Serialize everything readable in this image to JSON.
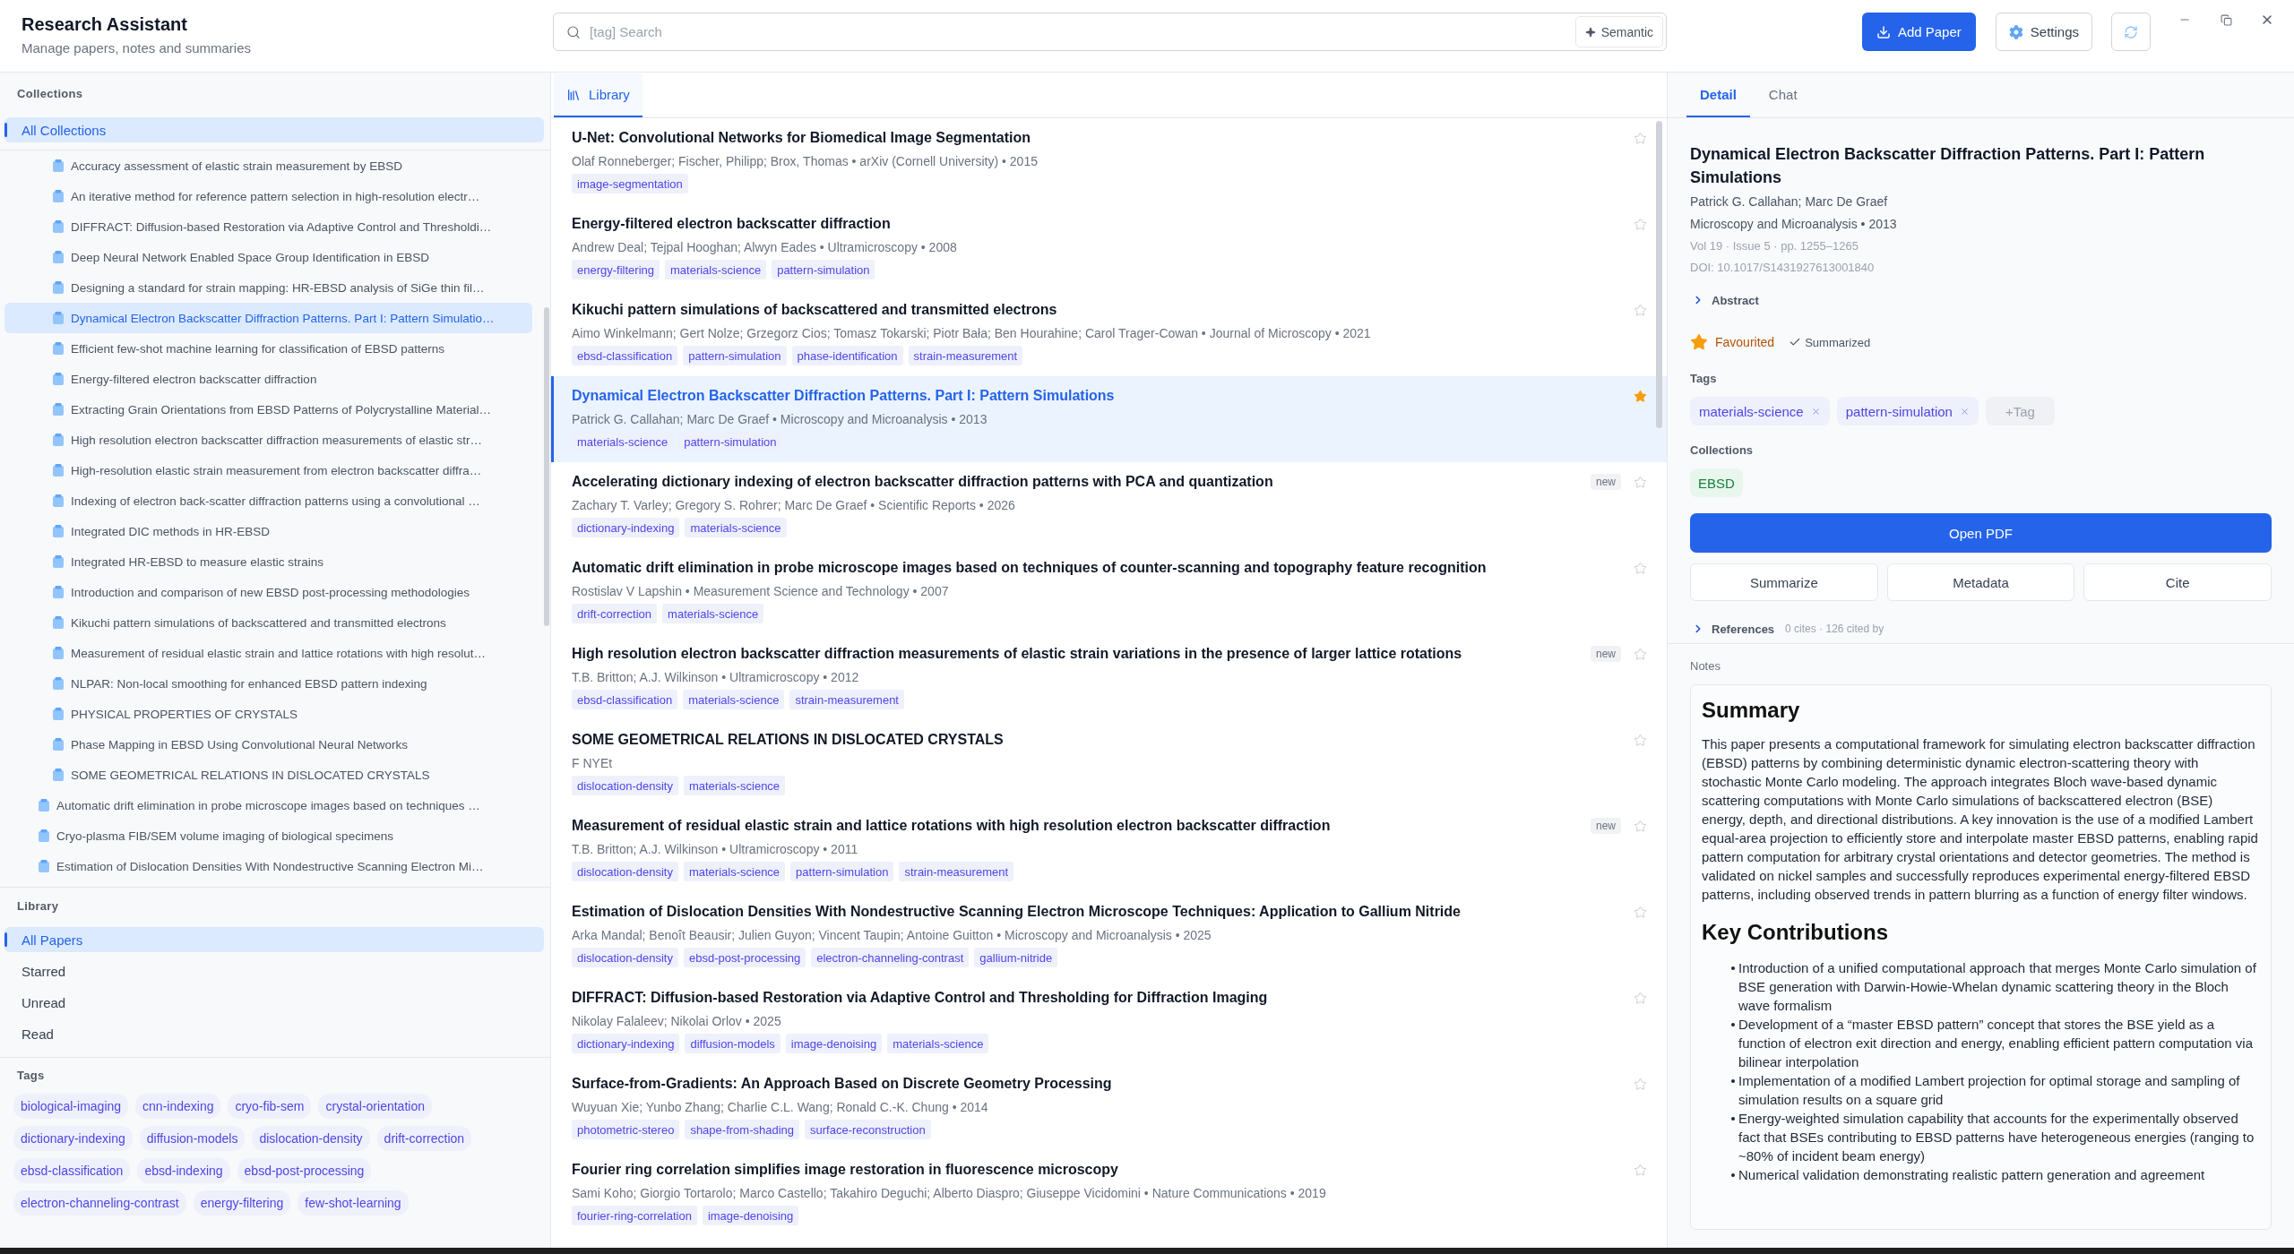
{
  "window": {
    "title": "Research Assistant",
    "subtitle": "Manage papers, notes and summaries"
  },
  "search": {
    "placeholder": "[tag] Search",
    "semantic_button": "Semantic"
  },
  "toolbar": {
    "add_paper": "Add Paper",
    "settings": "Settings"
  },
  "sidebar": {
    "collections": {
      "heading": "Collections",
      "all": {
        "label": "All Collections",
        "selected": true
      },
      "tree": [
        {
          "children": [
            {
              "label": "Accuracy assessment of elastic strain measurement by EBSD",
              "selected": false
            },
            {
              "label": "An iterative method for reference pattern selection in high-resolution electr…",
              "selected": false
            },
            {
              "label": "DIFFRACT: Diffusion-based Restoration via Adaptive Control and Thresholdi…",
              "selected": false
            },
            {
              "label": "Deep Neural Network Enabled Space Group Identification in EBSD",
              "selected": false
            },
            {
              "label": "Designing a standard for strain mapping: HR-EBSD analysis of SiGe thin fil…",
              "selected": false
            },
            {
              "label": "Dynamical Electron Backscatter Diffraction Patterns. Part I: Pattern Simulatio…",
              "selected": true
            },
            {
              "label": "Efficient few-shot machine learning for classification of EBSD patterns",
              "selected": false
            },
            {
              "label": "Energy-filtered electron backscatter diffraction",
              "selected": false
            },
            {
              "label": "Extracting Grain Orientations from EBSD Patterns of Polycrystalline Material…",
              "selected": false
            },
            {
              "label": "High resolution electron backscatter diffraction measurements of elastic str…",
              "selected": false
            },
            {
              "label": "High-resolution elastic strain measurement from electron backscatter diffra…",
              "selected": false
            },
            {
              "label": "Indexing of electron back-scatter diffraction patterns using a convolutional …",
              "selected": false
            },
            {
              "label": "Integrated DIC methods in HR-EBSD",
              "selected": false
            },
            {
              "label": "Integrated HR-EBSD to measure elastic strains",
              "selected": false
            },
            {
              "label": "Introduction and comparison of new EBSD post-processing methodologies",
              "selected": false
            },
            {
              "label": "Kikuchi pattern simulations of backscattered and transmitted electrons",
              "selected": false
            },
            {
              "label": "Measurement of residual elastic strain and lattice rotations with high resolut…",
              "selected": false
            },
            {
              "label": "NLPAR: Non-local smoothing for enhanced EBSD pattern indexing",
              "selected": false
            },
            {
              "label": "PHYSICAL PROPERTIES OF CRYSTALS",
              "selected": false
            },
            {
              "label": "Phase Mapping in EBSD Using Convolutional Neural Networks",
              "selected": false
            },
            {
              "label": "SOME GEOMETRICAL RELATIONS IN DISLOCATED CRYSTALS",
              "selected": false
            }
          ]
        },
        {
          "label": "Automatic drift elimination in probe microscope images based on techniques …",
          "selected": false
        },
        {
          "label": "Cryo-plasma FIB/SEM volume imaging of biological specimens",
          "selected": false
        },
        {
          "label": "Estimation of Dislocation Densities With Nondestructive Scanning Electron Mi…",
          "selected": false
        }
      ]
    },
    "library": {
      "heading": "Library",
      "items": [
        {
          "label": "All Papers",
          "selected": true
        },
        {
          "label": "Starred",
          "selected": false
        },
        {
          "label": "Unread",
          "selected": false
        },
        {
          "label": "Read",
          "selected": false
        }
      ]
    },
    "tags": {
      "heading": "Tags",
      "items": [
        "biological-imaging",
        "cnn-indexing",
        "cryo-fib-sem",
        "crystal-orientation",
        "dictionary-indexing",
        "diffusion-models",
        "dislocation-density",
        "drift-correction",
        "ebsd-classification",
        "ebsd-indexing",
        "ebsd-post-processing",
        "electron-channeling-contrast",
        "energy-filtering",
        "few-shot-learning"
      ]
    }
  },
  "center": {
    "tabs": [
      {
        "label": "Library",
        "selected": true
      }
    ],
    "papers": [
      {
        "title": "U-Net: Convolutional Networks for Biomedical Image Segmentation",
        "meta": "Olaf Ronneberger; Fischer, Philipp; Brox, Thomas • arXiv (Cornell University) • 2015",
        "tags": [
          "image-segmentation"
        ],
        "starred": false,
        "selected": false
      },
      {
        "title": "Energy-filtered electron backscatter diffraction",
        "meta": "Andrew Deal; Tejpal Hooghan; Alwyn Eades • Ultramicroscopy • 2008",
        "tags": [
          "energy-filtering",
          "materials-science",
          "pattern-simulation"
        ],
        "starred": false,
        "selected": false
      },
      {
        "title": "Kikuchi pattern simulations of backscattered and transmitted electrons",
        "meta": "Aimo Winkelmann; Gert Nolze; Grzegorz Cios; Tomasz Tokarski; Piotr Bała; Ben Hourahine; Carol Trager-Cowan • Journal of Microscopy • 2021",
        "tags": [
          "ebsd-classification",
          "pattern-simulation",
          "phase-identification",
          "strain-measurement"
        ],
        "starred": false,
        "selected": false
      },
      {
        "title": "Dynamical Electron Backscatter Diffraction Patterns. Part I: Pattern Simulations",
        "meta": "Patrick G. Callahan; Marc De Graef • Microscopy and Microanalysis • 2013",
        "tags": [
          "materials-science",
          "pattern-simulation"
        ],
        "starred": true,
        "selected": true
      },
      {
        "title": "Accelerating dictionary indexing of electron backscatter diffraction patterns with PCA and quantization",
        "meta": "Zachary T. Varley; Gregory S. Rohrer; Marc De Graef • Scientific Reports • 2026",
        "tags": [
          "dictionary-indexing",
          "materials-science"
        ],
        "badge": "new",
        "starred": false,
        "selected": false
      },
      {
        "title": "Automatic drift elimination in probe microscope images based on techniques of counter-scanning and topography feature recognition",
        "meta": "Rostislav V Lapshin • Measurement Science and Technology • 2007",
        "tags": [
          "drift-correction",
          "materials-science"
        ],
        "starred": false,
        "selected": false
      },
      {
        "title": "High resolution electron backscatter diffraction measurements of elastic strain variations in the presence of larger lattice rotations",
        "meta": "T.B. Britton; A.J. Wilkinson • Ultramicroscopy • 2012",
        "tags": [
          "ebsd-classification",
          "materials-science",
          "strain-measurement"
        ],
        "badge": "new",
        "starred": false,
        "selected": false
      },
      {
        "title": "SOME GEOMETRICAL RELATIONS IN DISLOCATED CRYSTALS",
        "meta": "F NYEt",
        "tags": [
          "dislocation-density",
          "materials-science"
        ],
        "starred": false,
        "selected": false
      },
      {
        "title": "Measurement of residual elastic strain and lattice rotations with high resolution electron backscatter diffraction",
        "meta": "T.B. Britton; A.J. Wilkinson • Ultramicroscopy • 2011",
        "tags": [
          "dislocation-density",
          "materials-science",
          "pattern-simulation",
          "strain-measurement"
        ],
        "badge": "new",
        "starred": false,
        "selected": false
      },
      {
        "title": "Estimation of Dislocation Densities With Nondestructive Scanning Electron Microscope Techniques: Application to Gallium Nitride",
        "meta": "Arka Mandal; Benoît Beausir; Julien Guyon; Vincent Taupin; Antoine Guitton • Microscopy and Microanalysis • 2025",
        "tags": [
          "dislocation-density",
          "ebsd-post-processing",
          "electron-channeling-contrast",
          "gallium-nitride"
        ],
        "starred": false,
        "selected": false
      },
      {
        "title": "DIFFRACT: Diffusion-based Restoration via Adaptive Control and Thresholding for Diffraction Imaging",
        "meta": "Nikolay Falaleev; Nikolai Orlov • 2025",
        "tags": [
          "dictionary-indexing",
          "diffusion-models",
          "image-denoising",
          "materials-science"
        ],
        "starred": false,
        "selected": false
      },
      {
        "title": "Surface-from-Gradients: An Approach Based on Discrete Geometry Processing",
        "meta": "Wuyuan Xie; Yunbo Zhang; Charlie C.L. Wang; Ronald C.-K. Chung • 2014",
        "tags": [
          "photometric-stereo",
          "shape-from-shading",
          "surface-reconstruction"
        ],
        "starred": false,
        "selected": false
      },
      {
        "title": "Fourier ring correlation simplifies image restoration in fluorescence microscopy",
        "meta": "Sami Koho; Giorgio Tortarolo; Marco Castello; Takahiro Deguchi; Alberto Diaspro; Giuseppe Vicidomini • Nature Communications • 2019",
        "tags": [
          "fourier-ring-correlation",
          "image-denoising"
        ],
        "starred": false,
        "selected": false
      }
    ]
  },
  "detail": {
    "tabs": [
      {
        "label": "Detail",
        "selected": true
      },
      {
        "label": "Chat",
        "selected": false
      }
    ],
    "title": "Dynamical Electron Backscatter Diffraction Patterns. Part I: Pattern Simulations",
    "authors": "Patrick G. Callahan; Marc De Graef",
    "venue": "Microscopy and Microanalysis • 2013",
    "volume": "Vol 19 · Issue 5 · pp. 1255–1265",
    "doi": "DOI: 10.1017/S1431927613001840",
    "abstract": {
      "label": "Abstract",
      "expanded": false
    },
    "favourited": {
      "label": "Favourited",
      "on": true
    },
    "summarized": {
      "label": "Summarized",
      "on": true
    },
    "tags_heading": "Tags",
    "tags": [
      "materials-science",
      "pattern-simulation"
    ],
    "add_tag": "+Tag",
    "collections_heading": "Collections",
    "collections": [
      "EBSD"
    ],
    "open_pdf": "Open PDF",
    "actions": [
      "Summarize",
      "Metadata",
      "Cite"
    ],
    "references": {
      "label": "References",
      "stats": "0 cites · 126 cited by",
      "expanded": false
    },
    "notes": {
      "heading": "Notes",
      "sections": [
        {
          "kind": "paragraph",
          "heading": "Summary",
          "text": "This paper presents a computational framework for simulating electron backscatter diffraction (EBSD) patterns by combining deterministic dynamic electron-scattering theory with stochastic Monte Carlo modeling. The approach integrates Bloch wave-based dynamic scattering computations with Monte Carlo simulations of backscattered electron (BSE) energy, depth, and directional distributions. A key innovation is the use of a modified Lambert equal-area projection to efficiently store and interpolate master EBSD patterns, enabling rapid pattern computation for arbitrary crystal orientations and detector geometries. The method is validated on nickel samples and successfully reproduces experimental energy-filtered EBSD patterns, including observed trends in pattern blurring as a function of energy filter windows."
        },
        {
          "kind": "bullets",
          "heading": "Key Contributions",
          "items": [
            "Introduction of a unified computational approach that merges Monte Carlo simulation of BSE generation with Darwin-Howie-Whelan dynamic scattering theory in the Bloch wave formalism",
            "Development of a “master EBSD pattern” concept that stores the BSE yield as a function of electron exit direction and energy, enabling efficient pattern computation via bilinear interpolation",
            "Implementation of a modified Lambert projection for optimal storage and sampling of simulation results on a square grid",
            "Energy-weighted simulation capability that accounts for the experimentally observed fact that BSEs contributing to EBSD patterns have heterogeneous energies (ranging to ~80% of incident beam energy)",
            "Numerical validation demonstrating realistic pattern generation and agreement"
          ]
        }
      ]
    }
  }
}
